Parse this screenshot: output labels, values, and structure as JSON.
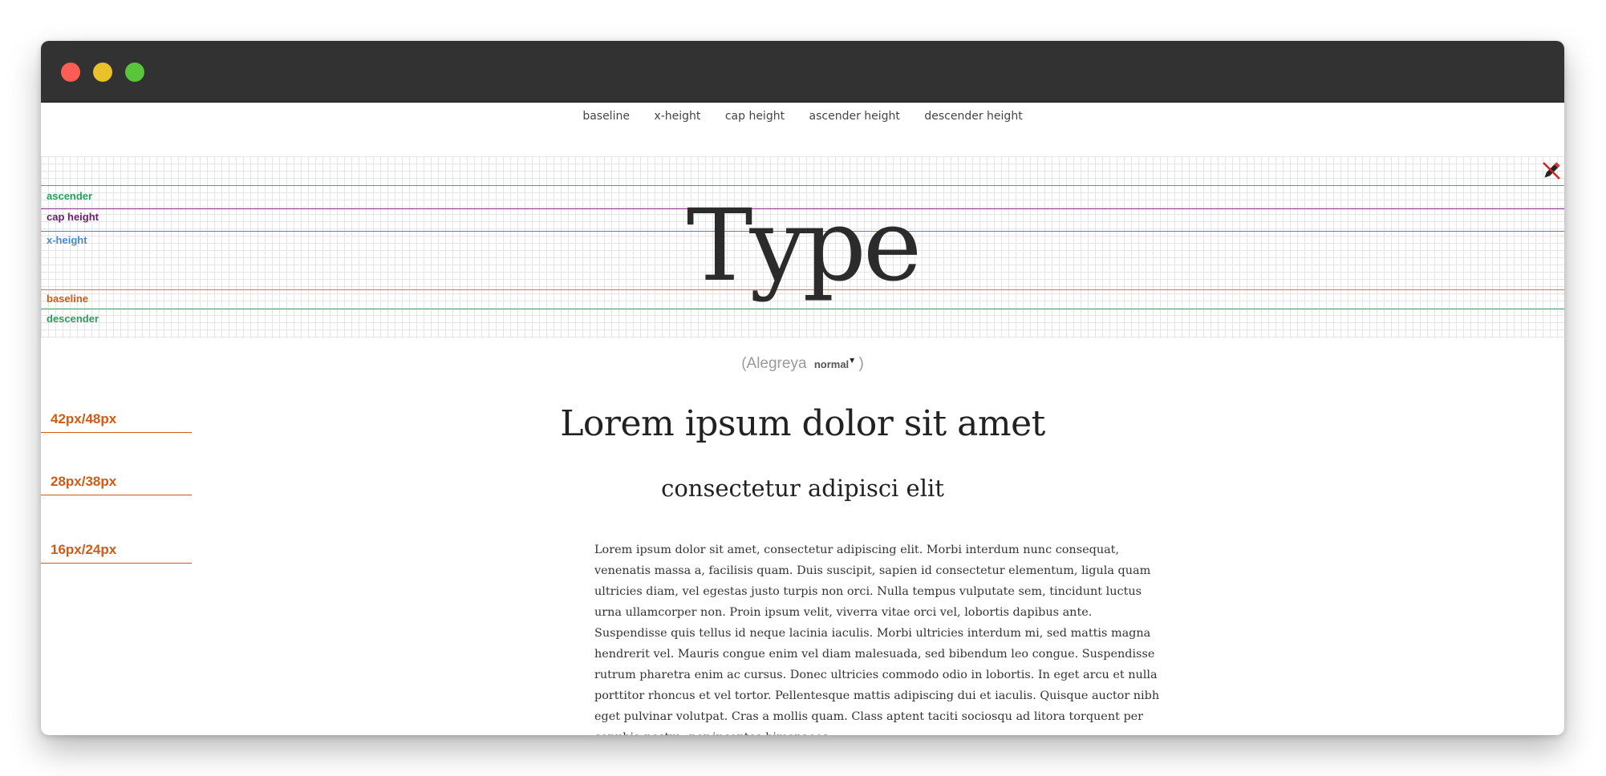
{
  "nav": {
    "items": [
      "baseline",
      "x-height",
      "cap height",
      "ascender height",
      "descender height"
    ]
  },
  "specimen": {
    "word": "Type",
    "guides": {
      "ascender": "ascender",
      "cap_height": "cap height",
      "x_height": "x-height",
      "baseline": "baseline",
      "descender": "descender"
    },
    "edit_icon": "pencil-icon"
  },
  "font_selector": {
    "open_paren": "(",
    "font_name": "Alegreya",
    "weight": "normal",
    "caret": "▾",
    "close_paren": ")"
  },
  "sizes": {
    "s1": "42px/48px",
    "s2": "28px/38px",
    "s3": "16px/24px"
  },
  "content": {
    "heading": "Lorem ipsum dolor sit amet",
    "subheading": "consectetur adipisci elit",
    "paragraph": "Lorem ipsum dolor sit amet, consectetur adipiscing elit. Morbi interdum nunc consequat, venenatis massa a, facilisis quam. Duis suscipit, sapien id consectetur elementum, ligula quam ultricies diam, vel egestas justo turpis non orci. Nulla tempus vulputate sem, tincidunt luctus urna ullamcorper non. Proin ipsum velit, viverra vitae orci vel, lobortis dapibus ante. Suspendisse quis tellus id neque lacinia iaculis. Morbi ultricies interdum mi, sed mattis magna hendrerit vel. Mauris congue enim vel diam malesuada, sed bibendum leo congue. Suspendisse rutrum pharetra enim ac cursus. Donec ultricies commodo odio in lobortis. In eget arcu et nulla porttitor rhoncus et vel tortor. Pellentesque mattis adipiscing dui et iaculis. Quisque auctor nibh eget pulvinar volutpat. Cras a mollis quam. Class aptent taciti sociosqu ad litora torquent per conubia nostra, per inceptos himenaeos."
  },
  "colors": {
    "titlebar": "#323232",
    "close": "#fc5d55",
    "minimize": "#e8c12b",
    "zoom": "#5ac53a",
    "ascender_line": "#2fb36a",
    "cap_line": "#8a2c8c",
    "x_line": "#4a89c9",
    "baseline_line": "#e07a2f",
    "size_label": "#d35a13"
  }
}
